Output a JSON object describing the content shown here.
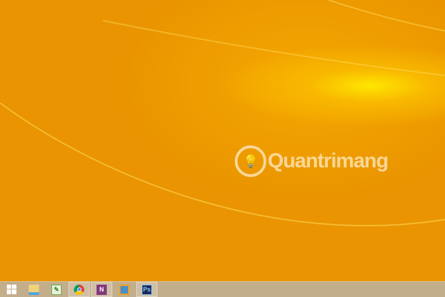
{
  "watermark": {
    "text": "Quantrimang"
  },
  "taskbar": {
    "items": [
      {
        "name": "start",
        "label": ""
      },
      {
        "name": "file-explorer",
        "label": ""
      },
      {
        "name": "paint",
        "label": ""
      },
      {
        "name": "chrome",
        "label": ""
      },
      {
        "name": "onenote",
        "label": "N"
      },
      {
        "name": "vmware",
        "label": ""
      },
      {
        "name": "photoshop",
        "label": "Ps"
      }
    ]
  },
  "colors": {
    "wallpaper": "#e89200",
    "taskbar": "#c3ae8c"
  }
}
